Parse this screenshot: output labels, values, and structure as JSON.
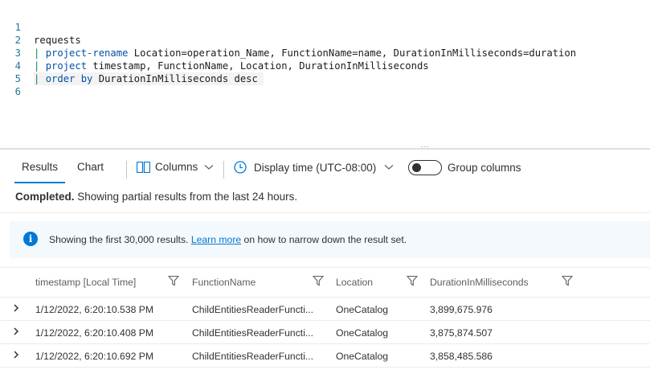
{
  "editor": {
    "lines": [
      {
        "no": "1",
        "pipe": "",
        "kw": "",
        "rest": "requests"
      },
      {
        "no": "2",
        "pipe": "| ",
        "kw": "project-rename",
        "rest": " Location=operation_Name, FunctionName=name, DurationInMilliseconds=duration"
      },
      {
        "no": "3",
        "pipe": "| ",
        "kw": "project",
        "rest": " timestamp, FunctionName, Location, DurationInMilliseconds"
      },
      {
        "no": "4",
        "pipe": "| ",
        "kw": "order by",
        "rest": " DurationInMilliseconds desc "
      },
      {
        "no": "5",
        "pipe": "",
        "kw": "",
        "rest": ""
      },
      {
        "no": "6",
        "pipe": "",
        "kw": "",
        "rest": ""
      }
    ],
    "splitter_dots": "..."
  },
  "toolbar": {
    "tab_results": "Results",
    "tab_chart": "Chart",
    "columns_label": "Columns",
    "display_time_label": "Display time (UTC-08:00)",
    "group_columns_label": "Group columns"
  },
  "status": {
    "bold": "Completed.",
    "text": " Showing partial results from the last 24 hours."
  },
  "banner": {
    "icon": "i",
    "text_before": "Showing the first 30,000 results. ",
    "link": "Learn more",
    "text_after": " on how to narrow down the result set."
  },
  "table": {
    "columns": [
      "timestamp [Local Time]",
      "FunctionName",
      "Location",
      "DurationInMilliseconds"
    ],
    "rows": [
      [
        "1/12/2022, 6:20:10.538 PM",
        "ChildEntitiesReaderFuncti...",
        "OneCatalog",
        "3,899,675.976"
      ],
      [
        "1/12/2022, 6:20:10.408 PM",
        "ChildEntitiesReaderFuncti...",
        "OneCatalog",
        "3,875,874.507"
      ],
      [
        "1/12/2022, 6:20:10.692 PM",
        "ChildEntitiesReaderFuncti...",
        "OneCatalog",
        "3,858,485.586"
      ]
    ]
  },
  "colors": {
    "accent": "#0078d4",
    "keyword": "#0451a5",
    "pipe": "#098658",
    "line_number": "#237893",
    "banner_bg": "#f3f9fd"
  },
  "icons": {
    "columns": "columns-icon",
    "clock": "clock-icon",
    "chevron": "chevron-down-icon",
    "filter": "filter-icon",
    "expand": "chevron-right-icon",
    "info": "info-icon"
  }
}
